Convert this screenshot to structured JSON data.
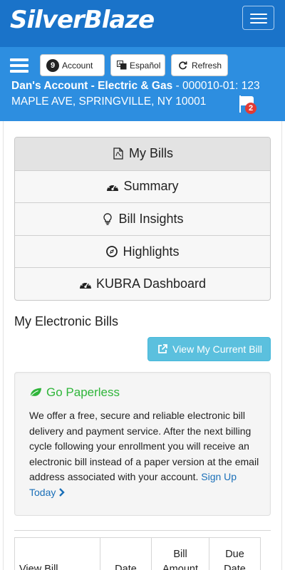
{
  "brand": "SilverBlaze",
  "toolbar": {
    "account_badge": "9",
    "account_label": "Account",
    "espanol_label": "Español",
    "refresh_label": "Refresh"
  },
  "account": {
    "name": "Dan's Account - Electric & Gas",
    "number_address": " - 000010-01: 123 MAPLE AVE, SPRINGVILLE, NY 10001",
    "flag_count": "2"
  },
  "nav": {
    "items": [
      {
        "label": "My Bills",
        "icon": "pdf-file-icon",
        "active": true
      },
      {
        "label": "Summary",
        "icon": "dashboard-gauge-icon",
        "active": false
      },
      {
        "label": "Bill Insights",
        "icon": "lightbulb-icon",
        "active": false
      },
      {
        "label": "Highlights",
        "icon": "compass-icon",
        "active": false
      },
      {
        "label": "KUBRA Dashboard",
        "icon": "dashboard-gauge-icon",
        "active": false
      }
    ]
  },
  "bills": {
    "section_title": "My Electronic Bills",
    "view_current_label": "View My Current Bill"
  },
  "paperless": {
    "title": "Go Paperless",
    "body": "We offer a free, secure and reliable electronic bill delivery and payment service. After the next billing cycle following your enrollment you will receive an electronic bill instead of a paper version at the email address associated with your account. ",
    "link_label": "Sign Up Today"
  },
  "table": {
    "headers": [
      "View Bill",
      "Date",
      "Bill Amount",
      "Due Date"
    ]
  },
  "colors": {
    "navbar": "#1a73c9",
    "banner": "#2d8ee0",
    "info_button": "#5bc0de",
    "paperless_green": "#2fb53a",
    "link": "#1a6fb8",
    "flag_badge": "#e23b35"
  }
}
